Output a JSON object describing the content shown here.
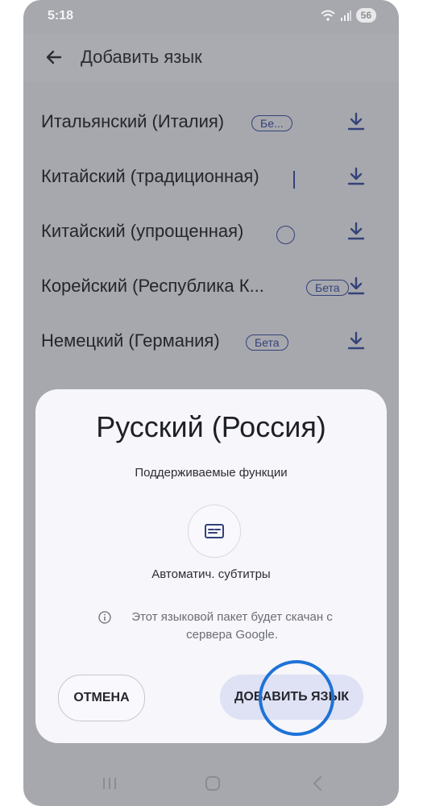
{
  "status_bar": {
    "time": "5:18",
    "battery": "56"
  },
  "appbar": {
    "title": "Добавить язык"
  },
  "languages": [
    {
      "label": "Итальянский (Италия)",
      "badge": "Бе..."
    },
    {
      "label": "Китайский (традиционная)",
      "badge": ""
    },
    {
      "label": "Китайский (упрощенная)",
      "badge": ""
    },
    {
      "label": "Корейский (Республика К...",
      "badge": "Бета"
    },
    {
      "label": "Немецкий (Германия)",
      "badge": "Бета"
    }
  ],
  "dialog": {
    "title": "Русский (Россия)",
    "subtitle": "Поддерживаемые функции",
    "feature_label": "Автоматич. субтитры",
    "info": "Этот языковой пакет будет скачан с сервера Google.",
    "cancel_label": "ОТМЕНА",
    "add_label": "ДОБАВИТЬ ЯЗЫК"
  },
  "icons": {
    "back": "arrow-left-icon",
    "download": "download-icon",
    "subtitles": "subtitles-icon",
    "info": "info-icon"
  },
  "colors": {
    "accent": "#34427a",
    "tap_indicator": "#1e73d6",
    "add_button_bg": "#dfe1f5"
  }
}
